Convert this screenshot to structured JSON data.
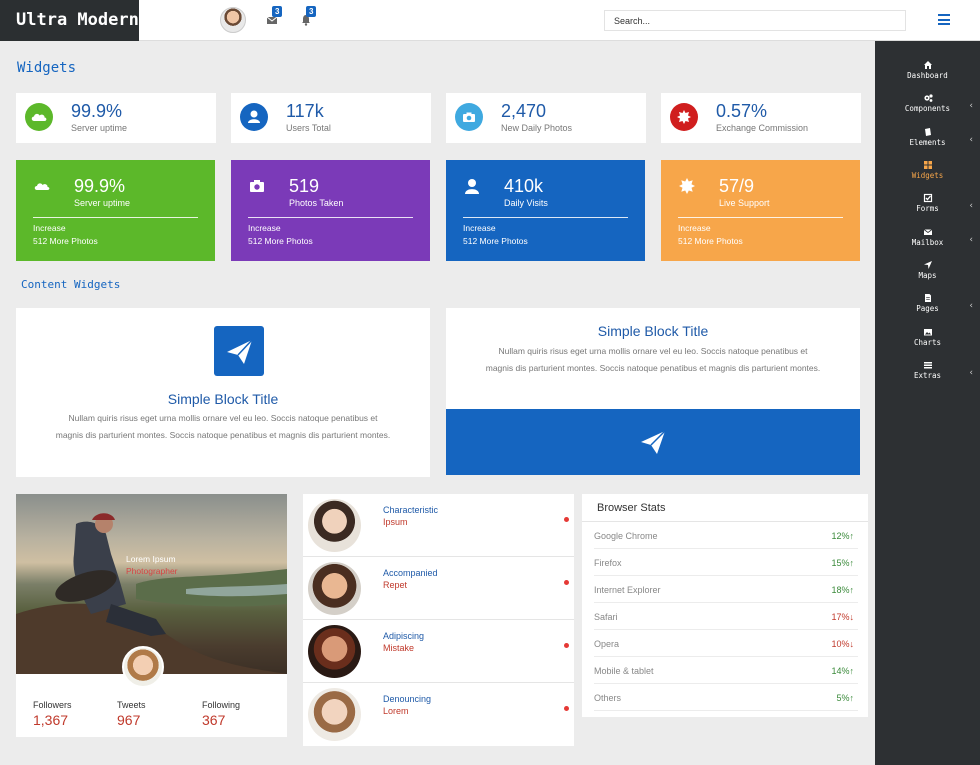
{
  "header": {
    "brand": "Ultra Modern",
    "mail_count": "3",
    "notif_count": "3",
    "search_placeholder": "Search..."
  },
  "sidebar": {
    "items": [
      {
        "label": "Dashboard",
        "icon": "home-icon",
        "chevron": false,
        "active": false
      },
      {
        "label": "Components",
        "icon": "cogs-icon",
        "chevron": true,
        "active": false
      },
      {
        "label": "Elements",
        "icon": "book-icon",
        "chevron": true,
        "active": false
      },
      {
        "label": "Widgets",
        "icon": "grid-icon",
        "chevron": false,
        "active": true
      },
      {
        "label": "Forms",
        "icon": "checkbox-icon",
        "chevron": true,
        "active": false
      },
      {
        "label": "Mailbox",
        "icon": "envelope-icon",
        "chevron": true,
        "active": false
      },
      {
        "label": "Maps",
        "icon": "location-arrow-icon",
        "chevron": false,
        "active": false
      },
      {
        "label": "Pages",
        "icon": "file-icon",
        "chevron": true,
        "active": false
      },
      {
        "label": "Charts",
        "icon": "image-icon",
        "chevron": false,
        "active": false
      },
      {
        "label": "Extras",
        "icon": "list-icon",
        "chevron": true,
        "active": false
      }
    ]
  },
  "page": {
    "title": "Widgets",
    "content_title": "Content Widgets"
  },
  "stats": [
    {
      "value": "99.9%",
      "label": "Server uptime",
      "icon": "cloud-icon",
      "color": "#5cb82a"
    },
    {
      "value": "117k",
      "label": "Users Total",
      "icon": "user-icon",
      "color": "#1565c0"
    },
    {
      "value": "2,470",
      "label": "New Daily Photos",
      "icon": "camera-icon",
      "color": "#3fa9e0"
    },
    {
      "value": "0.57%",
      "label": "Exchange Commission",
      "icon": "certificate-icon",
      "color": "#d01e1e"
    }
  ],
  "color_cards": [
    {
      "value": "99.9%",
      "label": "Server uptime",
      "increase": "Increase",
      "more": "512 More Photos",
      "icon": "cloud-icon",
      "color": "#5cb82a"
    },
    {
      "value": "519",
      "label": "Photos Taken",
      "increase": "Increase",
      "more": "512 More Photos",
      "icon": "camera-icon",
      "color": "#7b3ab8"
    },
    {
      "value": "410k",
      "label": "Daily Visits",
      "increase": "Increase",
      "more": "512 More Photos",
      "icon": "user-icon",
      "color": "#1565c0"
    },
    {
      "value": "57/9",
      "label": "Live Support",
      "increase": "Increase",
      "more": "512 More Photos",
      "icon": "certificate-icon",
      "color": "#f7a64a"
    }
  ],
  "blocks": [
    {
      "title": "Simple Block Title",
      "text": "Nullam quiris risus eget urna mollis ornare vel eu leo. Soccis natoque penatibus et magnis dis parturient montes. Soccis natoque penatibus et magnis dis parturient montes."
    },
    {
      "title": "Simple Block Title",
      "text": "Nullam quiris risus eget urna mollis ornare vel eu leo. Soccis natoque penatibus et magnis dis parturient montes. Soccis natoque penatibus et magnis dis parturient montes."
    }
  ],
  "profile": {
    "name": "Lorem Ipsum",
    "role": "Photographer",
    "stats": [
      {
        "label": "Followers",
        "value": "1,367"
      },
      {
        "label": "Tweets",
        "value": "967"
      },
      {
        "label": "Following",
        "value": "367"
      }
    ]
  },
  "list": [
    {
      "title": "Characteristic",
      "sub": "Ipsum",
      "avatar_color": "#c9a98a"
    },
    {
      "title": "Accompanied",
      "sub": "Repet",
      "avatar_color": "#b07a55"
    },
    {
      "title": "Adipiscing",
      "sub": "Mistake",
      "avatar_color": "#9a4a2a"
    },
    {
      "title": "Denouncing",
      "sub": "Lorem",
      "avatar_color": "#d9b59a"
    }
  ],
  "browser_stats": {
    "title": "Browser Stats",
    "rows": [
      {
        "name": "Google Chrome",
        "pct": "12%",
        "trend": "up"
      },
      {
        "name": "Firefox",
        "pct": "15%",
        "trend": "up"
      },
      {
        "name": "Internet Explorer",
        "pct": "18%",
        "trend": "up"
      },
      {
        "name": "Safari",
        "pct": "17%",
        "trend": "down"
      },
      {
        "name": "Opera",
        "pct": "10%",
        "trend": "down"
      },
      {
        "name": "Mobile & tablet",
        "pct": "14%",
        "trend": "up"
      },
      {
        "name": "Others",
        "pct": "5%",
        "trend": "up"
      }
    ]
  }
}
